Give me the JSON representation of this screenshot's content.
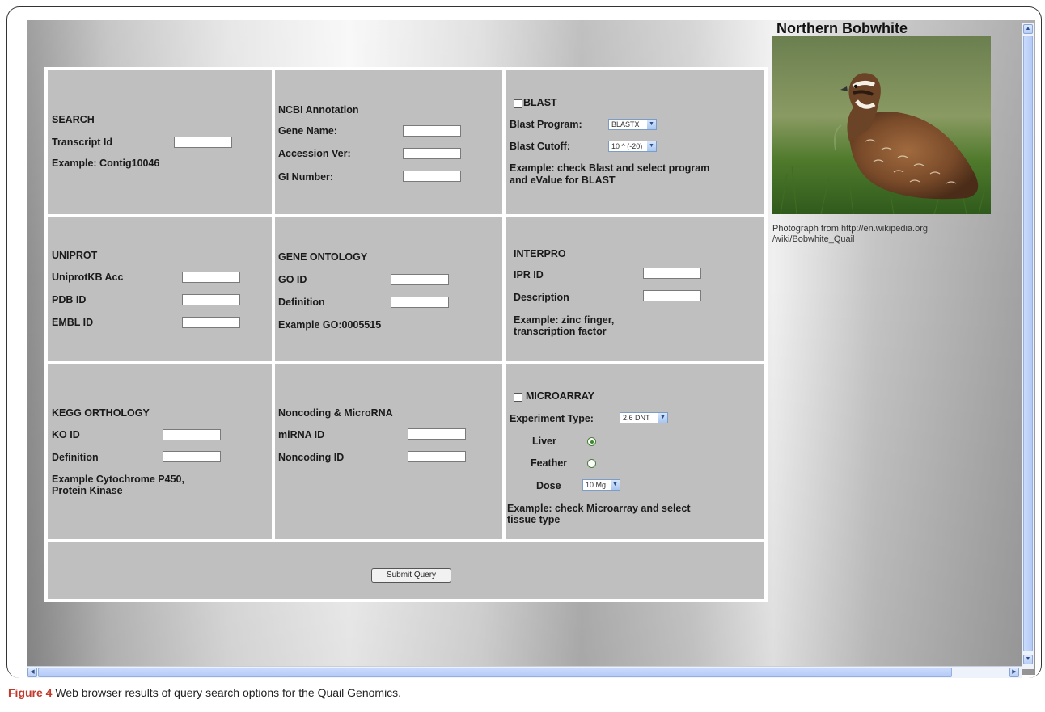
{
  "search": {
    "title": "SEARCH",
    "transcript_label": "Transcript Id",
    "example": "Example: Contig10046"
  },
  "ncbi": {
    "title": "NCBI Annotation",
    "gene_name_label": "Gene Name:",
    "accession_label": "Accession Ver:",
    "gi_label": "GI Number:"
  },
  "blast": {
    "checkbox_label": "BLAST",
    "program_label": "Blast Program:",
    "program_value": "BLASTX",
    "cutoff_label": "Blast Cutoff:",
    "cutoff_value": "10 ^ (-20)",
    "example_line1": "Example: check Blast and select program",
    "example_line2": "and eValue for BLAST"
  },
  "uniprot": {
    "title": "UNIPROT",
    "acc_label": "UniprotKB Acc",
    "pdb_label": "PDB ID",
    "embl_label": "EMBL ID"
  },
  "gene_ontology": {
    "title": "GENE ONTOLOGY",
    "go_id_label": "GO ID",
    "definition_label": "Definition",
    "example": "Example GO:0005515"
  },
  "interpro": {
    "title": "INTERPRO",
    "ipr_label": "IPR ID",
    "description_label": "Description",
    "example_line1": "Example: zinc finger,",
    "example_line2": "transcription factor"
  },
  "kegg": {
    "title": "KEGG ORTHOLOGY",
    "ko_label": "KO ID",
    "definition_label": "Definition",
    "example_line1": "Example Cytochrome P450,",
    "example_line2": "Protein Kinase"
  },
  "noncoding": {
    "title": "Noncoding & MicroRNA",
    "mirna_label": "miRNA ID",
    "noncoding_label": "Noncoding ID"
  },
  "microarray": {
    "checkbox_label": "MICROARRAY",
    "experiment_label": "Experiment Type:",
    "experiment_value": "2,6 DNT",
    "liver_label": "Liver",
    "feather_label": "Feather",
    "dose_label": "Dose",
    "dose_value": "10 Mg",
    "example_line1": "Example: check Microarray and select",
    "example_line2": "tissue type"
  },
  "submit": {
    "label": "Submit Query"
  },
  "sidebar": {
    "title": "Northern Bobwhite",
    "caption_line1": "Photograph from http://en.wikipedia.org",
    "caption_line2": "/wiki/Bobwhite_Quail"
  },
  "figure": {
    "label": "Figure 4",
    "caption": " Web browser results of query search options for the Quail Genomics."
  },
  "icons": {
    "dropdown": "chevron-down-icon",
    "scroll_up": "arrow-up-icon",
    "scroll_down": "arrow-down-icon",
    "scroll_left": "arrow-left-icon",
    "scroll_right": "arrow-right-icon"
  }
}
